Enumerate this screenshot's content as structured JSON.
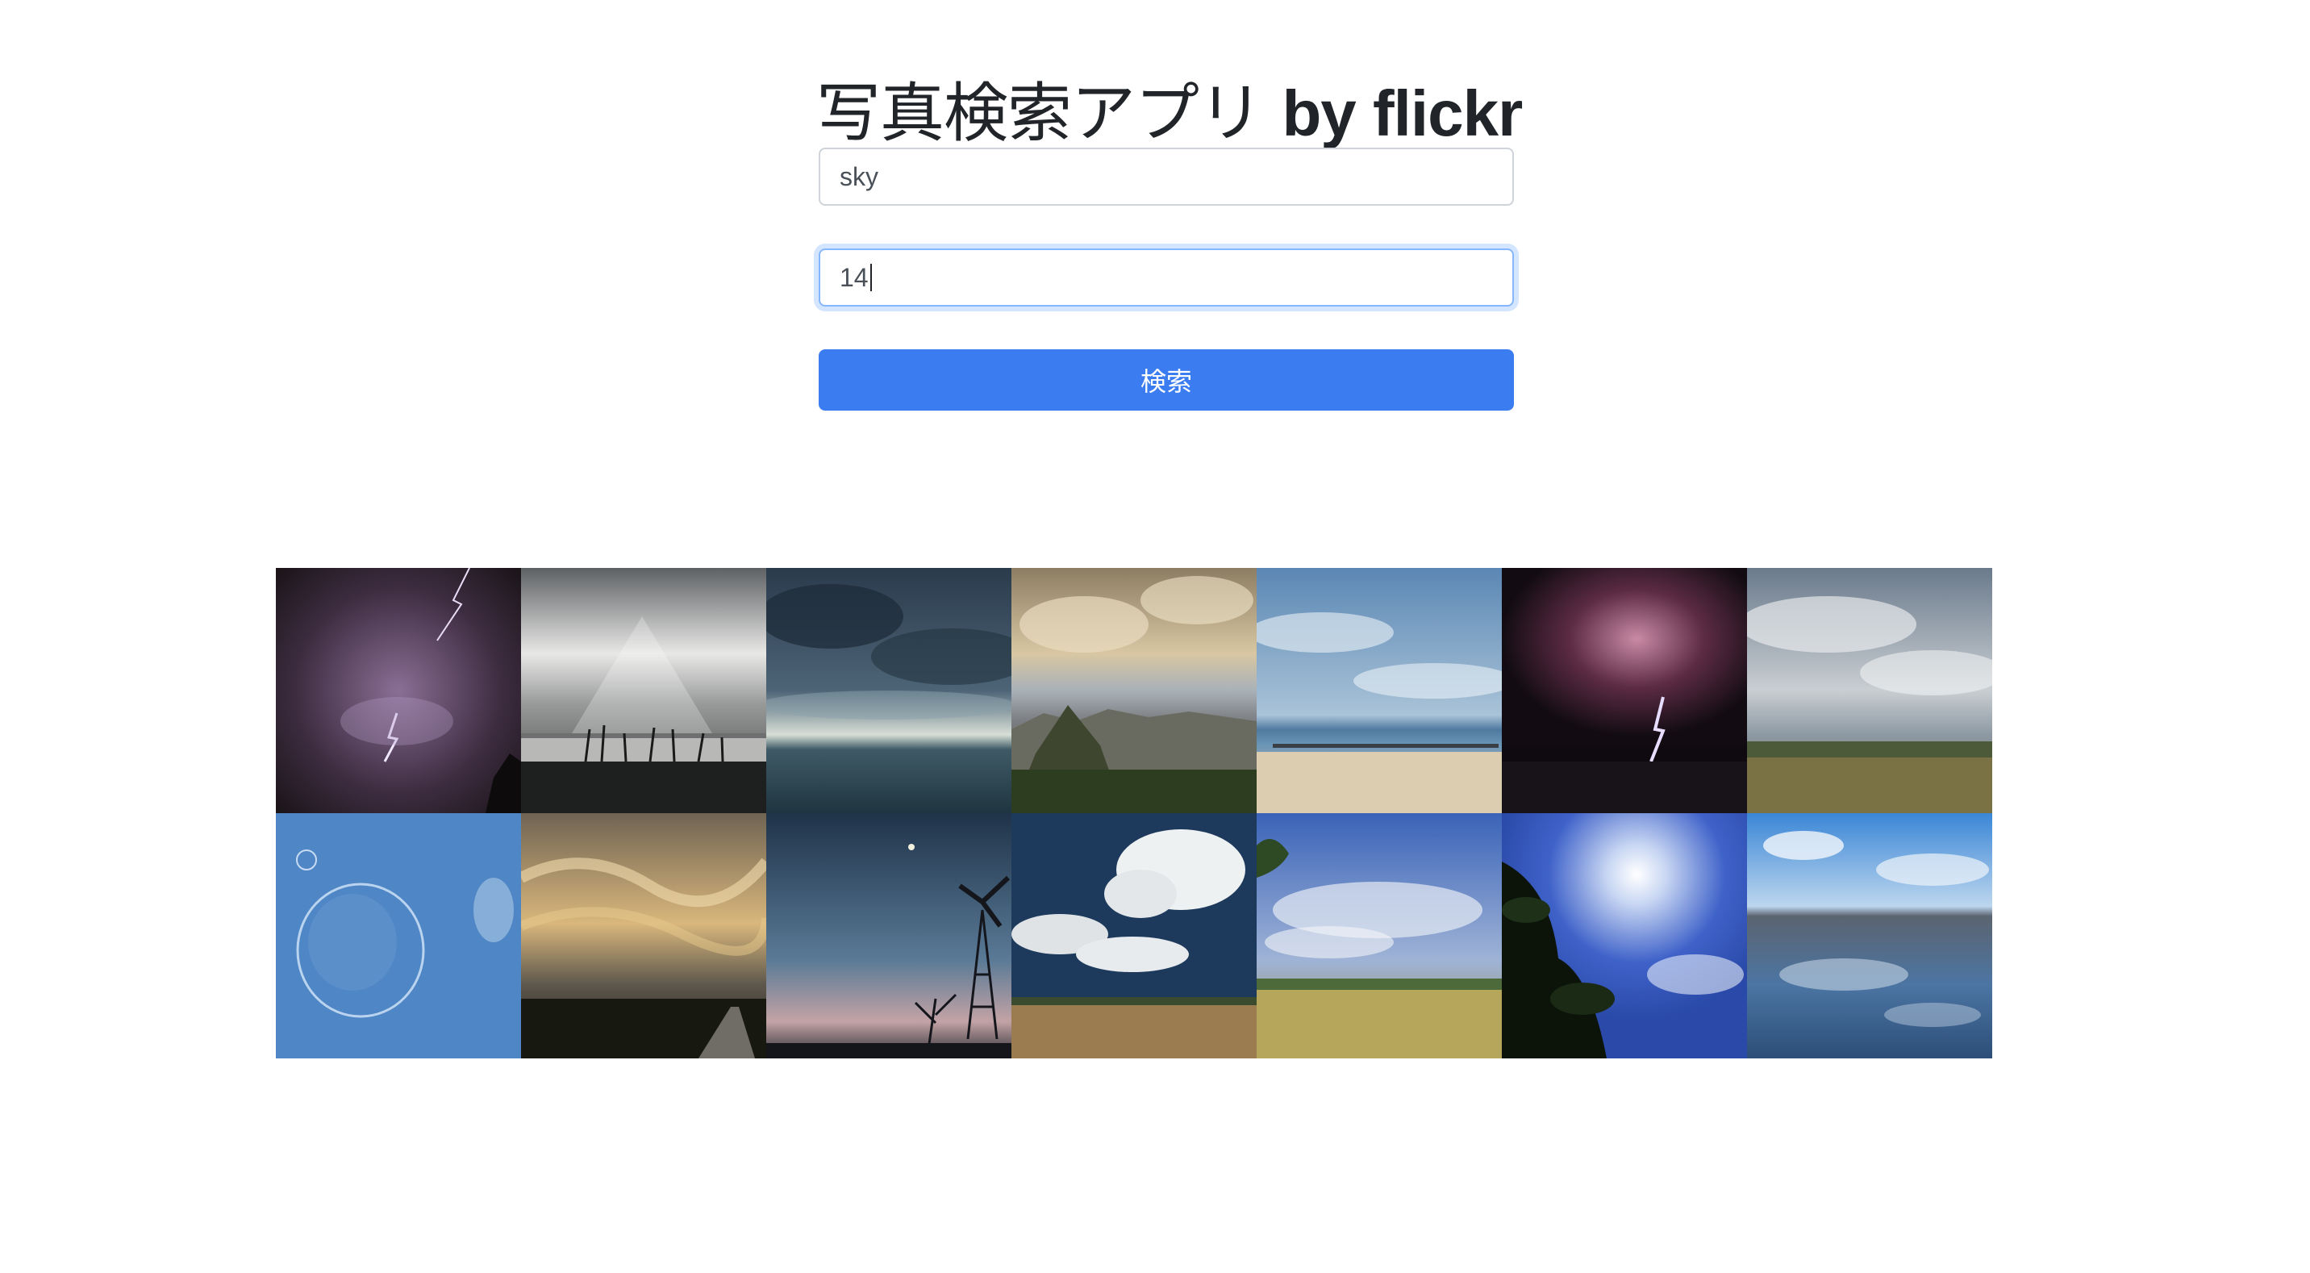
{
  "header": {
    "title_jp": "写真検索アプリ",
    "title_latin": "by flickr"
  },
  "form": {
    "keyword_value": "sky",
    "count_value": "14",
    "search_label": "検索"
  },
  "colors": {
    "primary_button": "#3b7df0",
    "focus_border": "#86b7fe"
  },
  "photos": [
    {
      "subject": "purple lightning night sky"
    },
    {
      "subject": "sun rays over lake with reeds"
    },
    {
      "subject": "dark storm clouds over sea"
    },
    {
      "subject": "golden clouds over city and hills"
    },
    {
      "subject": "blue cloudy sky over pier and beach"
    },
    {
      "subject": "pink lightning storm at night"
    },
    {
      "subject": "grey clouds over marshland"
    },
    {
      "subject": "soap bubble in blue sky"
    },
    {
      "subject": "dramatic golden clouds over road"
    },
    {
      "subject": "windmill silhouette at dusk with moon"
    },
    {
      "subject": "white cumulus clouds over field"
    },
    {
      "subject": "blue sky clouds over green field"
    },
    {
      "subject": "sun through leaves with blue sky"
    },
    {
      "subject": "clouds reflected on wet beach"
    }
  ]
}
